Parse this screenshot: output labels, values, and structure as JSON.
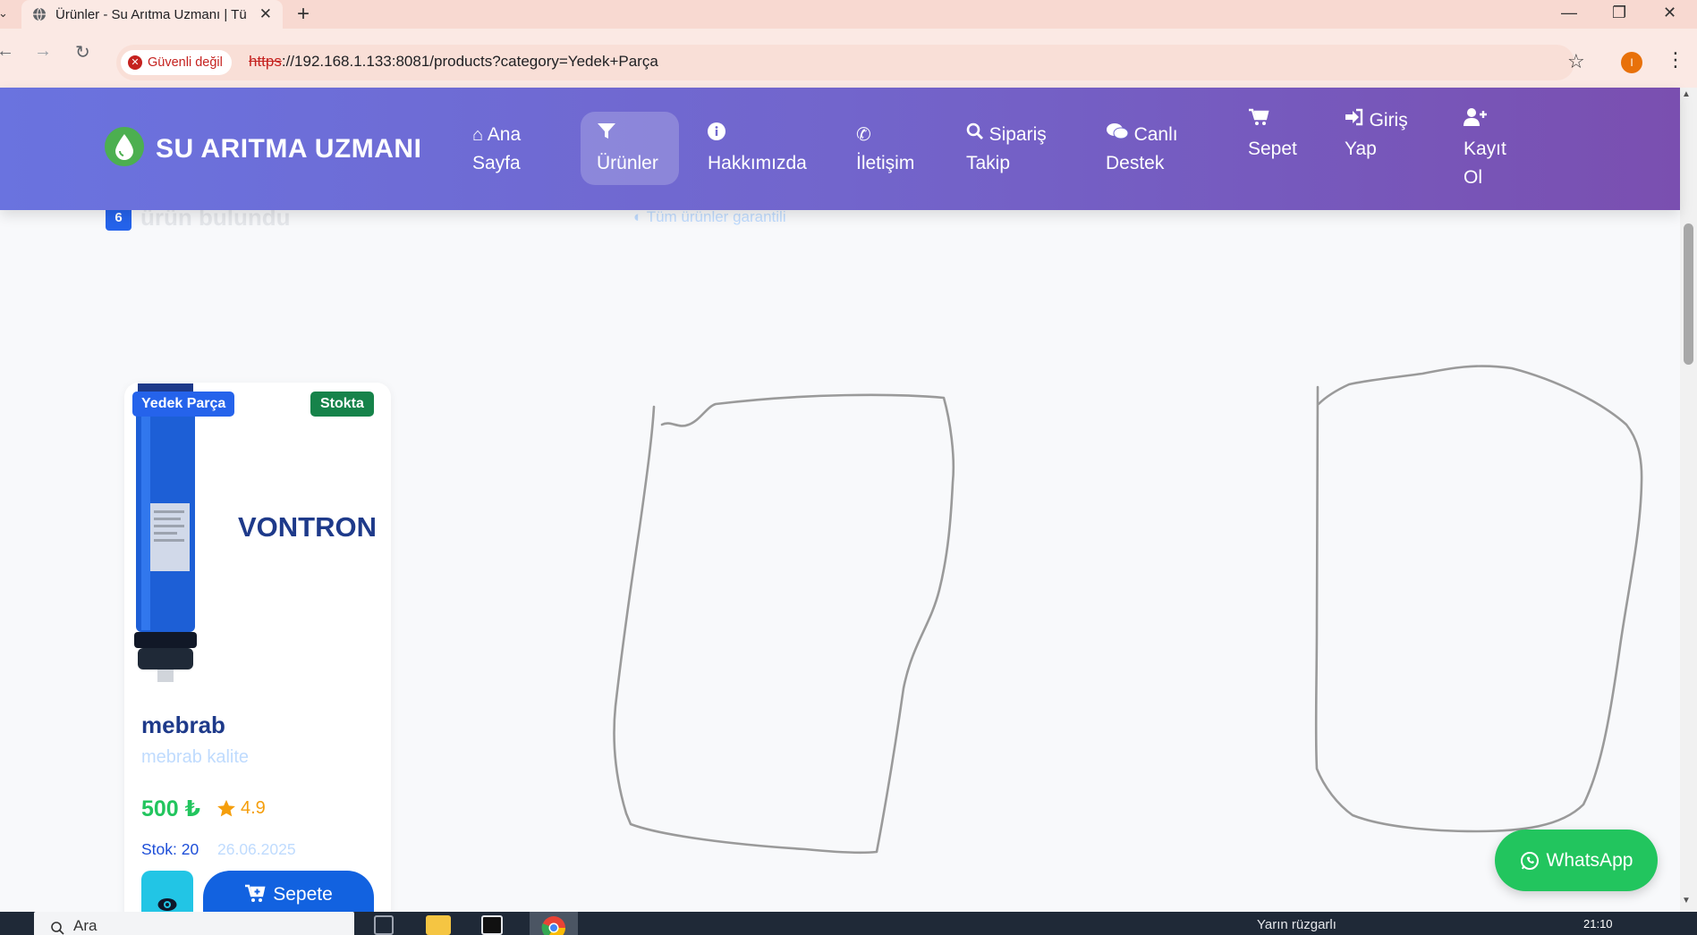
{
  "browser": {
    "tab_title": "Ürünler - Su Arıtma Uzmanı | Tü",
    "security_label": "Güvenli değil",
    "url_protocol": "https",
    "url_rest": "://192.168.1.133:8081/products?category=Yedek+Parça",
    "profile_initial": "I"
  },
  "header": {
    "logo_text": "SU ARITMA UZMANI",
    "nav": [
      {
        "label_line1": "Ana",
        "label_line2": "Sayfa",
        "icon": "home-icon"
      },
      {
        "label_line1": "",
        "label_line2": "Ürünler",
        "icon": "filter-icon",
        "active": true
      },
      {
        "label_line1": "",
        "label_line2": "Hakkımızda",
        "icon": "info-icon"
      },
      {
        "label_line1": "",
        "label_line2": "İletişim",
        "icon": "phone-icon"
      },
      {
        "label_line1": "Sipariş",
        "label_line2": "Takip",
        "icon": "search-icon"
      },
      {
        "label_line1": "Canlı",
        "label_line2": "Destek",
        "icon": "comments-icon"
      },
      {
        "label_line1": "",
        "label_line2": "Sepet",
        "icon": "cart-icon"
      },
      {
        "label_line1": "Giriş",
        "label_line2": "Yap",
        "icon": "sign-in-icon"
      },
      {
        "label_line1": "",
        "label_line2": "Kayıt",
        "label_line3": "Ol",
        "icon": "user-plus-icon"
      }
    ]
  },
  "results": {
    "count": "6",
    "count_text": "ürün bulundu",
    "warranty_text": "Tüm ürünler garantili"
  },
  "product": {
    "category_badge": "Yedek Parça",
    "stock_badge": "Stokta",
    "image_brand": "VONTRON",
    "name": "mebrab",
    "description": "mebrab kalite",
    "price": "500 ₺",
    "rating": "4.9",
    "stock": "Stok: 20",
    "date": "26.06.2025",
    "cart_label": "Sepete"
  },
  "whatsapp_label": "WhatsApp",
  "taskbar": {
    "search_placeholder": "Ara",
    "weather": "Yarın rüzgarlı",
    "time": "21:10"
  },
  "colors": {
    "header_start": "#6a73df",
    "header_end": "#7a4fb0",
    "primary": "#2563eb",
    "success": "#22c55e",
    "stock_badge": "#16834a"
  }
}
